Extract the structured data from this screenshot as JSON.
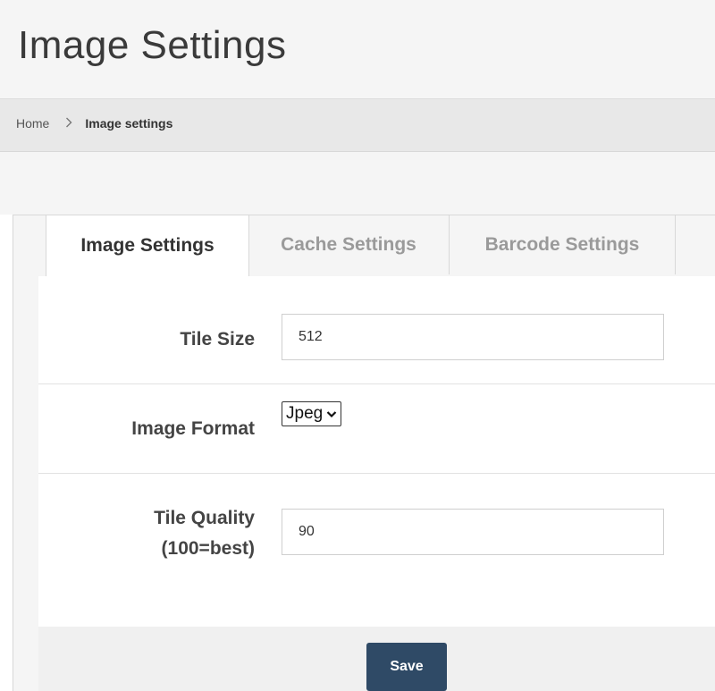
{
  "header": {
    "title": "Image Settings"
  },
  "breadcrumb": {
    "home": "Home",
    "separator": ">",
    "current": "Image settings"
  },
  "tabs": [
    {
      "label": "Image Settings",
      "active": true
    },
    {
      "label": "Cache Settings",
      "active": false
    },
    {
      "label": "Barcode Settings",
      "active": false
    }
  ],
  "form": {
    "tile_size": {
      "label": "Tile Size",
      "value": "512"
    },
    "image_format": {
      "label": "Image Format",
      "value": "Jpeg"
    },
    "tile_quality": {
      "label_line1": "Tile Quality",
      "label_line2": "(100=best)",
      "value": "90"
    },
    "save_label": "Save"
  },
  "colors": {
    "save_button": "#2f4a66",
    "tab_inactive_text": "#9a9a9a"
  },
  "icons": {
    "breadcrumb_separator": "chevron-right-icon",
    "select_arrow": "chevron-down-icon"
  }
}
